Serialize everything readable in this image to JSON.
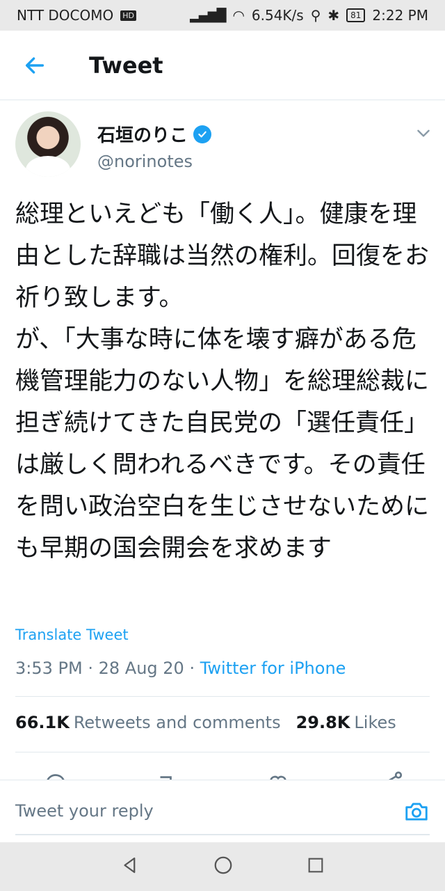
{
  "status_bar": {
    "carrier": "NTT DOCOMO",
    "hd_badge": "HD",
    "speed": "6.54K/s",
    "battery": "81",
    "time": "2:22 PM"
  },
  "header": {
    "title": "Tweet"
  },
  "author": {
    "name": "石垣のりこ",
    "handle": "@norinotes"
  },
  "tweet": {
    "text": "総理といえども「働く人」。健康を理由とした辞職は当然の権利。回復をお祈り致します。\nが、「大事な時に体を壊す癖がある危機管理能力のない人物」を総理総裁に担ぎ続けてきた自民党の「選任責任」は厳しく問われるべきです。その責任を問い政治空白を生じさせないためにも早期の国会開会を求めます",
    "translate_label": "Translate Tweet",
    "time": "3:53 PM",
    "date": "28 Aug 20",
    "source": "Twitter for iPhone"
  },
  "stats": {
    "retweets_count": "66.1K",
    "retweets_label": "Retweets and comments",
    "likes_count": "29.8K",
    "likes_label": "Likes"
  },
  "reply": {
    "placeholder": "Tweet your reply"
  },
  "colors": {
    "accent": "#1da1f2",
    "muted": "#657786"
  },
  "icons": [
    "back-arrow-icon",
    "verified-badge-icon",
    "chevron-down-icon",
    "camera-icon",
    "nav-back-icon",
    "nav-home-icon",
    "nav-recents-icon"
  ]
}
